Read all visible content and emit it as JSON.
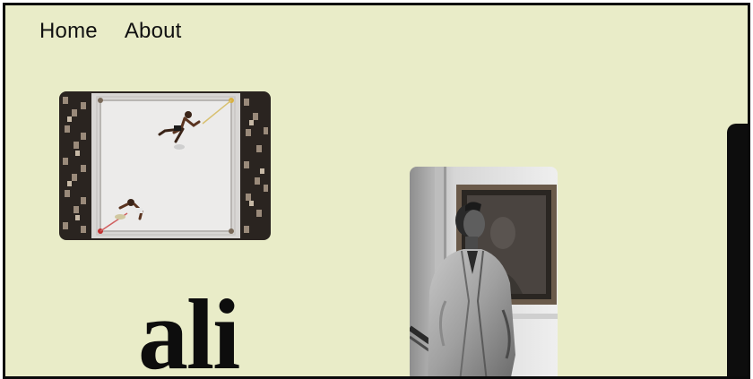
{
  "nav": {
    "items": [
      {
        "label": "Home"
      },
      {
        "label": "About"
      }
    ]
  },
  "hero": {
    "title": "ali"
  },
  "images": {
    "ring": {
      "description_icon": "boxing-ring-aerial-photo"
    },
    "portrait": {
      "description_icon": "boxer-portrait-photo"
    },
    "edge": {
      "description_icon": "cropped-photo"
    }
  },
  "colors": {
    "background": "#e9ecc8",
    "border": "#0a0a0a",
    "text": "#111111"
  }
}
